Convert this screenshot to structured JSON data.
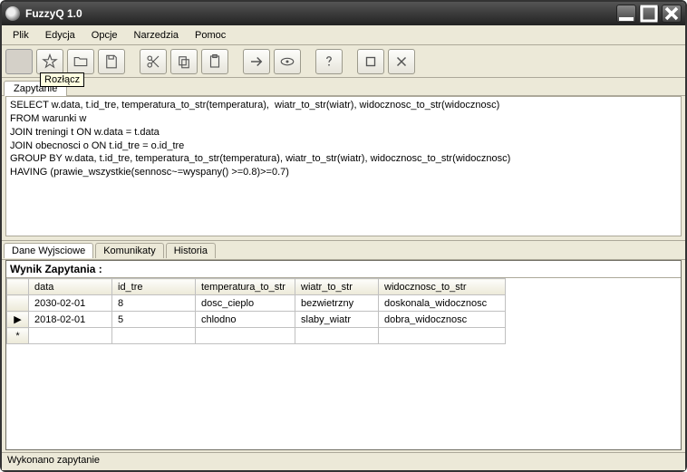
{
  "window": {
    "title": "FuzzyQ 1.0"
  },
  "menu": {
    "items": [
      "Plik",
      "Edycja",
      "Opcje",
      "Narzedzia",
      "Pomoc"
    ]
  },
  "toolbar": {
    "tooltip": "Rozłącz"
  },
  "tabs": {
    "query": "Zapytanie",
    "output": "Dane Wyjsciowe",
    "messages": "Komunikaty",
    "history": "Historia"
  },
  "query_text": "SELECT w.data, t.id_tre, temperatura_to_str(temperatura),  wiatr_to_str(wiatr), widocznosc_to_str(widocznosc)\nFROM warunki w\nJOIN treningi t ON w.data = t.data\nJOIN obecnosci o ON t.id_tre = o.id_tre\nGROUP BY w.data, t.id_tre, temperatura_to_str(temperatura), wiatr_to_str(wiatr), widocznosc_to_str(widocznosc)\nHAVING (prawie_wszystkie(sennosc~=wyspany() >=0.8)>=0.7)",
  "results": {
    "title": "Wynik Zapytania :",
    "columns": [
      "data",
      "id_tre",
      "temperatura_to_str",
      "wiatr_to_str",
      "widocznosc_to_str"
    ],
    "rows": [
      {
        "indicator": "",
        "cells": [
          "2030-02-01",
          "8",
          "dosc_cieplo",
          "bezwietrzny",
          "doskonala_widocznosc"
        ]
      },
      {
        "indicator": "▶",
        "cells": [
          "2018-02-01",
          "5",
          "chlodno",
          "slaby_wiatr",
          "dobra_widocznosc"
        ]
      }
    ],
    "newrow_marker": "*"
  },
  "status": "Wykonano zapytanie"
}
